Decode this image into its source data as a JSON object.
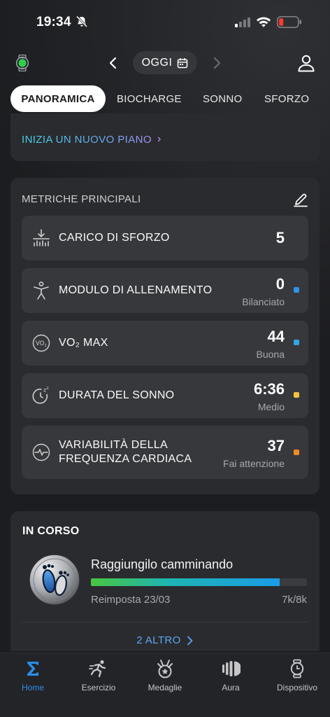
{
  "status_bar": {
    "time": "19:34"
  },
  "header": {
    "date_label": "OGGI"
  },
  "tabs": [
    {
      "label": "PANORAMICA",
      "active": true
    },
    {
      "label": "BIOCHARGE",
      "active": false
    },
    {
      "label": "SONNO",
      "active": false
    },
    {
      "label": "SFORZO",
      "active": false
    }
  ],
  "plan_card": {
    "link_label": "INIZIA UN NUOVO PIANO"
  },
  "metrics": {
    "title": "METRICHE PRINCIPALI",
    "items": [
      {
        "label": "CARICO DI SFORZO",
        "value": "5",
        "sub": "",
        "dot_color": ""
      },
      {
        "label": "MODULO DI ALLENAMENTO",
        "value": "0",
        "sub": "Bilanciato",
        "dot_color": "#2f93e8"
      },
      {
        "label": "VO₂ MAX",
        "value": "44",
        "sub": "Buona",
        "dot_color": "#2fa6e8"
      },
      {
        "label": "DURATA DEL SONNO",
        "value": "6:36",
        "sub": "Medio",
        "dot_color": "#f2c43c"
      },
      {
        "label_line1": "VARIABILITÀ DELLA",
        "label_line2": "FREQUENZA CARDIACA",
        "value": "37",
        "sub": "Fai attenzione",
        "dot_color": "#ef8a24"
      }
    ]
  },
  "in_progress": {
    "title": "IN CORSO",
    "task_name": "Raggiungilo camminando",
    "progress": 0.875,
    "reset_label": "Reimposta 23/03",
    "count_label": "7k/8k",
    "more_label": "2 ALTRO"
  },
  "bottom_nav": [
    {
      "label": "Home",
      "icon": "home-sigma-icon",
      "active": true
    },
    {
      "label": "Esercizio",
      "icon": "running-icon",
      "active": false
    },
    {
      "label": "Medaglie",
      "icon": "medal-icon",
      "active": false
    },
    {
      "label": "Aura",
      "icon": "aura-icon",
      "active": false
    },
    {
      "label": "Dispositivo",
      "icon": "watch-device-icon",
      "active": false
    }
  ],
  "colors": {
    "accent": "#2a8ee8",
    "background": "#1c1d20",
    "card": "#2a2b2e",
    "row": "#37383c"
  }
}
